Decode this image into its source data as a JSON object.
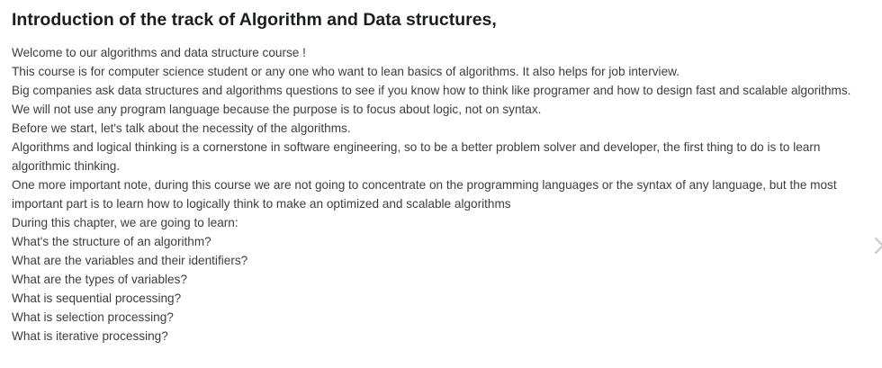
{
  "title": "Introduction of the track of Algorithm and Data structures,",
  "lines": [
    "Welcome to our algorithms and data structure course !",
    "This course is for computer science student or any one who want to lean basics of algorithms. It also helps for job interview.",
    "Big companies ask data structures and algorithms questions to see if you know how to think like programer and how to design fast and scalable algorithms.",
    "We will not use any program language because the purpose is to focus about logic, not on syntax.",
    "Before we start, let's talk about the necessity of the algorithms.",
    "Algorithms and logical thinking is a cornerstone in software engineering, so to be a better problem solver and developer, the first thing to do is to learn",
    "algorithmic thinking.",
    "One more important note, during this course we are not going to concentrate on the programming languages or the syntax of any language, but the most",
    "important part is to learn how to logically think to make an optimized and scalable algorithms",
    "During this chapter, we are going to learn:",
    "What's the structure of an algorithm?",
    "What are the variables and their identifiers?",
    "What are the types of variables?",
    "What is sequential processing?",
    "What is selection processing?",
    "What is iterative processing?"
  ],
  "icons": {
    "next": "chevron-right-icon"
  },
  "colors": {
    "title": "#1c1d1f",
    "text": "#3d3d3d",
    "icon": "#c8c8c8"
  }
}
